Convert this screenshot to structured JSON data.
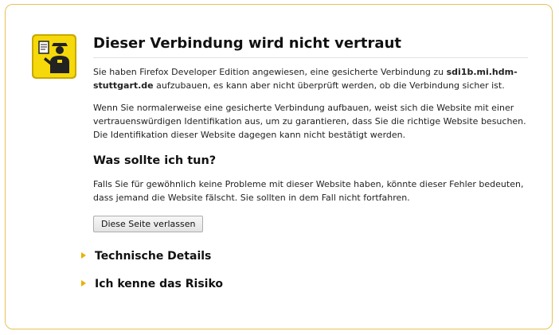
{
  "page": {
    "title": "Dieser Verbindung wird nicht vertraut",
    "intro_prefix": "Sie haben Firefox Developer Edition angewiesen, eine gesicherte Verbindung zu ",
    "host": "sdi1b.mi.hdm-stuttgart.de",
    "intro_suffix": " aufzubauen, es kann aber nicht überprüft werden, ob die Verbindung sicher ist.",
    "explanation": "Wenn Sie normalerweise eine gesicherte Verbindung aufbauen, weist sich die Website mit einer vertrauenswürdigen Identifikation aus, um zu garantieren, dass Sie die richtige Website besuchen. Die Identifikation dieser Website dagegen kann nicht bestätigt werden.",
    "what_to_do_heading": "Was sollte ich tun?",
    "what_to_do_text": "Falls Sie für gewöhnlich keine Probleme mit dieser Website haben, könnte dieser Fehler bedeuten, dass jemand die Website fälscht. Sie sollten in dem Fall nicht fortfahren.",
    "leave_button": "Diese Seite verlassen"
  },
  "expanders": {
    "technical_details": "Technische Details",
    "understand_risks": "Ich kenne das Risiko"
  },
  "colors": {
    "accent_border": "#e6c25a",
    "expander_arrow": "#e8b100",
    "icon_yellow": "#f5d90a"
  },
  "icons": {
    "header_icon": "identity-officer-icon",
    "expander_icon": "triangle-right-icon"
  }
}
